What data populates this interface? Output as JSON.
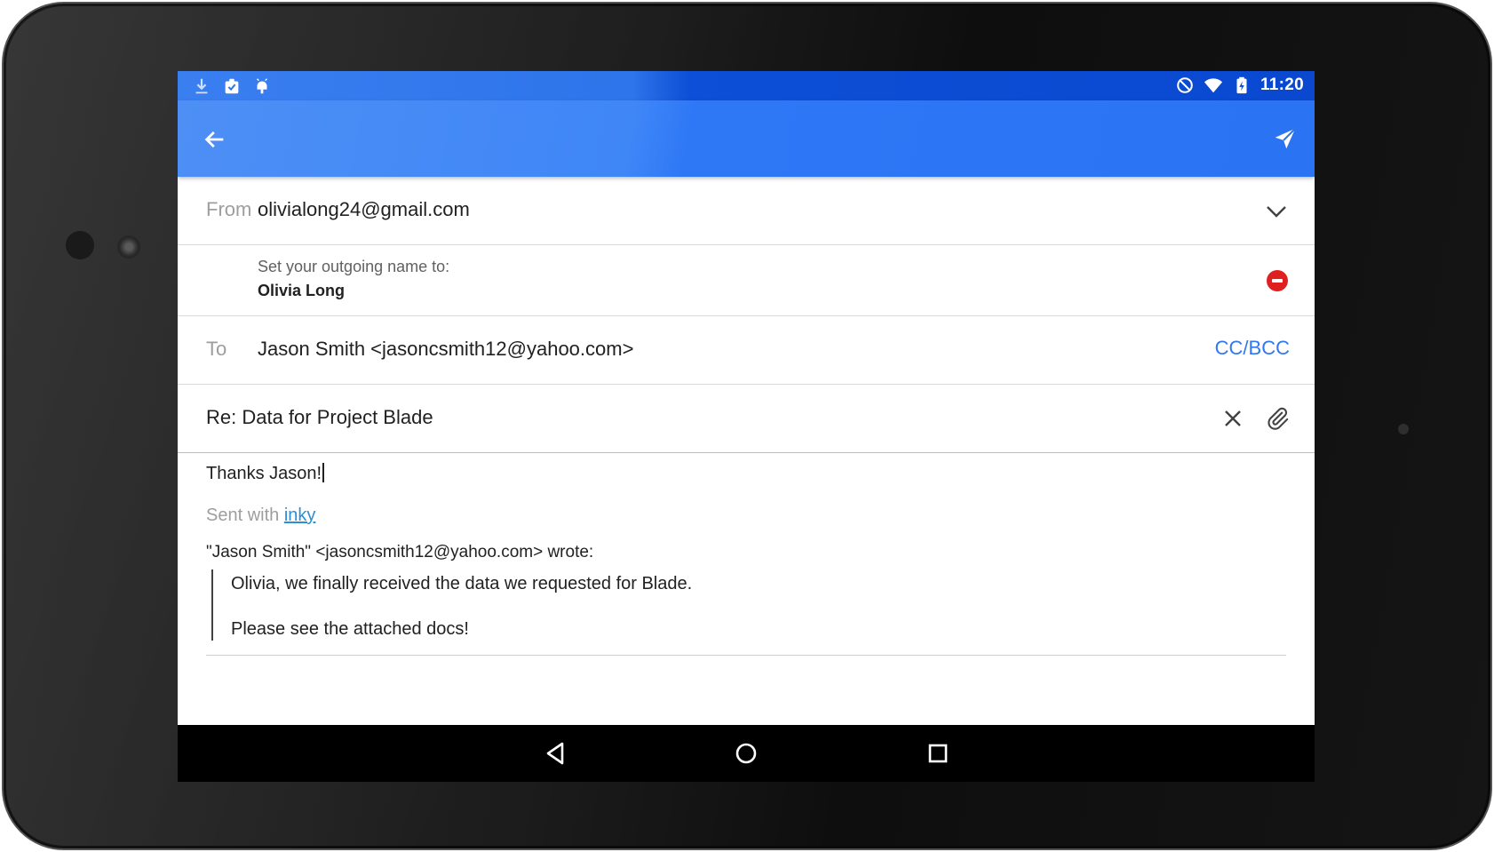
{
  "status_bar": {
    "time": "11:20",
    "left_icons": [
      "download-icon",
      "clipboard-check-icon",
      "android-icon"
    ],
    "right_icons": [
      "do-not-disturb-icon",
      "wifi-icon",
      "battery-charging-icon"
    ]
  },
  "app_bar": {
    "back_icon": "arrow-left-icon",
    "send_icon": "send-icon",
    "accent_color": "#2e78f6"
  },
  "compose": {
    "from_label": "From",
    "from_value": "olivialong24@gmail.com",
    "outgoing_prompt": "Set your outgoing name to:",
    "outgoing_name": "Olivia Long",
    "to_label": "To",
    "to_value": "Jason Smith <jasoncsmith12@yahoo.com>",
    "cc_bcc_label": "CC/BCC",
    "subject": "Re: Data for Project Blade",
    "body": "Thanks Jason!",
    "signature_prefix": "Sent with",
    "signature_link": "inky",
    "quote_header": "\"Jason Smith\" <jasoncsmith12@yahoo.com> wrote:",
    "quote_line_1": "Olivia, we finally received the data we requested for Blade.",
    "quote_line_2": "Please see the attached docs!"
  },
  "nav_bar": {
    "icons": [
      "back-triangle-icon",
      "home-circle-icon",
      "recents-square-icon"
    ]
  }
}
